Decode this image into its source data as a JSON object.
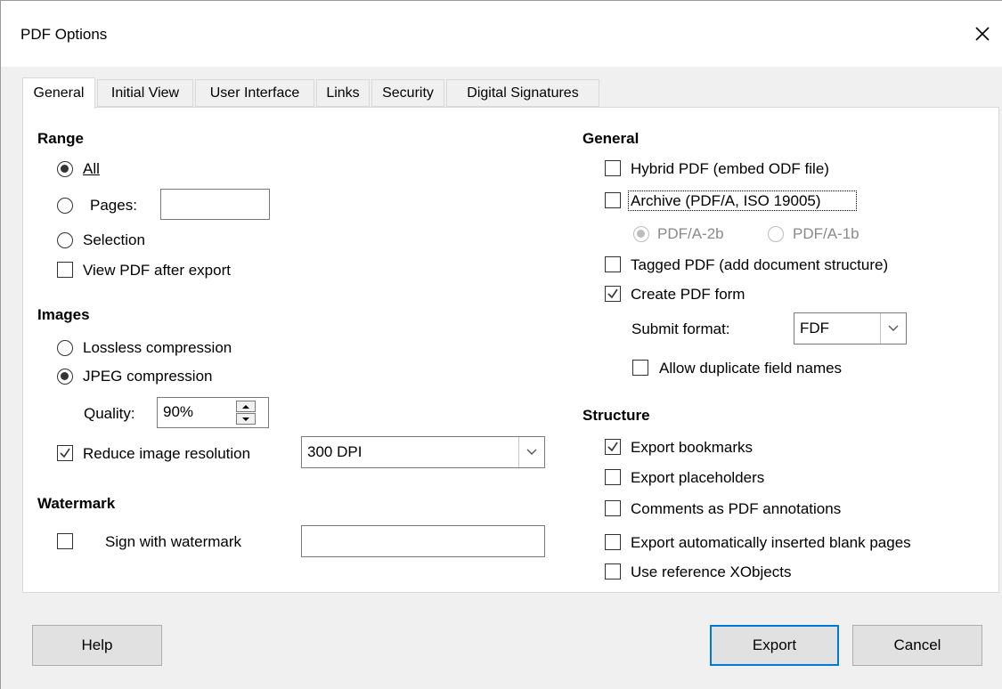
{
  "dialog": {
    "title": "PDF Options"
  },
  "tabs": [
    {
      "label": "General",
      "active": true
    },
    {
      "label": "Initial View"
    },
    {
      "label": "User Interface"
    },
    {
      "label": "Links"
    },
    {
      "label": "Security"
    },
    {
      "label": "Digital Signatures"
    }
  ],
  "range": {
    "heading": "Range",
    "all_label": "All",
    "pages_label": "Pages:",
    "pages_value": "",
    "selection_label": "Selection",
    "view_pdf_label": "View PDF after export"
  },
  "images": {
    "heading": "Images",
    "lossless_label": "Lossless compression",
    "jpeg_label": "JPEG compression",
    "quality_label": "Quality:",
    "quality_value": "90%",
    "reduce_label": "Reduce image resolution",
    "resolution_value": "300 DPI"
  },
  "watermark": {
    "heading": "Watermark",
    "sign_label": "Sign with watermark",
    "watermark_value": ""
  },
  "general": {
    "heading": "General",
    "hybrid_label": "Hybrid PDF (embed ODF file)",
    "archive_label": "Archive (PDF/A, ISO 19005)",
    "pdfa2b_label": "PDF/A-2b",
    "pdfa1b_label": "PDF/A-1b",
    "tagged_label": "Tagged PDF (add document structure)",
    "create_form_label": "Create PDF form",
    "submit_format_label": "Submit format:",
    "submit_format_value": "FDF",
    "allow_duplicate_label": "Allow duplicate field names"
  },
  "structure": {
    "heading": "Structure",
    "export_bookmarks_label": "Export bookmarks",
    "export_placeholders_label": "Export placeholders",
    "comments_label": "Comments as PDF annotations",
    "blank_pages_label": "Export automatically inserted blank pages",
    "xobjects_label": "Use reference XObjects"
  },
  "buttons": {
    "help": "Help",
    "export": "Export",
    "cancel": "Cancel"
  },
  "icons": {
    "close": "close-icon",
    "check": "checkmark-icon",
    "dropdown": "chevron-down-icon",
    "spin_up": "spin-up-icon",
    "spin_down": "spin-down-icon"
  },
  "colors": {
    "accent": "#0078d7",
    "panel": "#ffffff",
    "window": "#f0f0f0"
  }
}
